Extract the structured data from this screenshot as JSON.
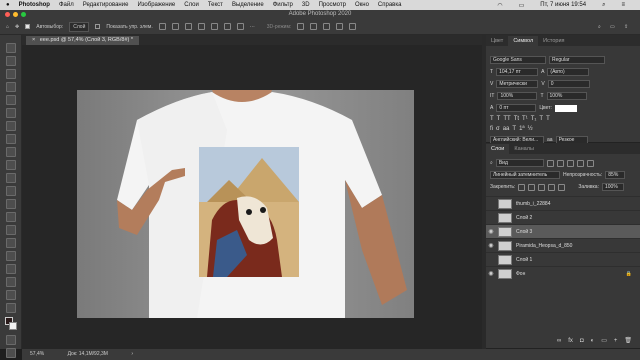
{
  "menubar": {
    "app_name": "Photoshop",
    "items": [
      "Файл",
      "Редактирование",
      "Изображение",
      "Слои",
      "Текст",
      "Выделение",
      "Фильтр",
      "3D",
      "Просмотр",
      "Окно",
      "Справка"
    ],
    "date_time": "Пт, 7 июня 19:54"
  },
  "window": {
    "title": "Adobe Photoshop 2020"
  },
  "options_bar": {
    "autoselect_label": "Автовыбор:",
    "autoselect_value": "Слой",
    "show_transform_label": "Показать упр. элем.",
    "mode_3d_label": "3D-режим:"
  },
  "document": {
    "tab_title": "eee.psd @ 57,4% (Слой 3, RGB/8#) *"
  },
  "status_bar": {
    "zoom": "57,4%",
    "doc_info": "Док: 14,1M/92,3M"
  },
  "top_panel": {
    "tabs": [
      "Цвет",
      "Символ",
      "История"
    ],
    "active_tab": "Символ"
  },
  "character": {
    "font_family": "Google Sans",
    "font_style": "Regular",
    "size": "104,17 пт",
    "leading": "(Авто)",
    "kerning": "Метрически",
    "tracking": "0",
    "vertical_scale": "100%",
    "horizontal_scale": "100%",
    "baseline_shift": "0 пт",
    "color_label": "Цвет:",
    "language": "Английский: Вели...",
    "antialias_label": "aa",
    "antialias": "Резкое"
  },
  "layers_panel": {
    "tabs": [
      "Слои",
      "Каналы"
    ],
    "active_tab": "Слои",
    "filter_kind": "Вид",
    "blend_mode": "Линейный затемнитель",
    "opacity_label": "Непрозрачность:",
    "opacity": "85%",
    "lock_label": "Закрепить:",
    "fill_label": "Заливка:",
    "fill": "100%",
    "layers": [
      {
        "name": "thumb_i_22884",
        "visible": false,
        "selected": false,
        "linked": true
      },
      {
        "name": "Слой 2",
        "visible": false,
        "selected": false,
        "linked": false
      },
      {
        "name": "Слой 3",
        "visible": true,
        "selected": true,
        "linked": false
      },
      {
        "name": "Piramida_Heopsa_d_850",
        "visible": true,
        "selected": false,
        "linked": false
      },
      {
        "name": "Слой 1",
        "visible": false,
        "selected": false,
        "linked": false
      },
      {
        "name": "Фон",
        "visible": true,
        "selected": false,
        "linked": false
      }
    ]
  },
  "colors": {
    "accent": "#4a90e2",
    "canvas_bg": "#8c8c8c",
    "panel_bg": "#383838",
    "selected_row": "#5a5a5a"
  }
}
